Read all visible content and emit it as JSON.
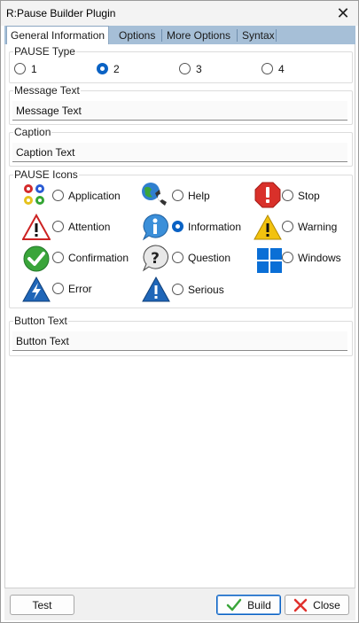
{
  "window": {
    "title": "R:Pause Builder Plugin"
  },
  "tabs": [
    {
      "label": "General Information"
    },
    {
      "label": "Options"
    },
    {
      "label": "More Options"
    },
    {
      "label": "Syntax"
    }
  ],
  "pause_type": {
    "label": "PAUSE Type",
    "options": [
      "1",
      "2",
      "3",
      "4"
    ],
    "selected": "2"
  },
  "message_text": {
    "label": "Message Text",
    "value": "Message Text"
  },
  "caption": {
    "label": "Caption",
    "value": "Caption Text"
  },
  "pause_icons": {
    "label": "PAUSE Icons",
    "options": [
      {
        "label": "Application",
        "icon": "gears-icon",
        "selected": false
      },
      {
        "label": "Help",
        "icon": "help-phone-icon",
        "selected": false
      },
      {
        "label": "Stop",
        "icon": "stop-icon",
        "selected": false
      },
      {
        "label": "Attention",
        "icon": "attention-icon",
        "selected": false
      },
      {
        "label": "Information",
        "icon": "information-icon",
        "selected": true
      },
      {
        "label": "Warning",
        "icon": "warning-icon",
        "selected": false
      },
      {
        "label": "Confirmation",
        "icon": "confirmation-icon",
        "selected": false
      },
      {
        "label": "Question",
        "icon": "question-icon",
        "selected": false
      },
      {
        "label": "Windows",
        "icon": "windows-icon",
        "selected": false
      },
      {
        "label": "Error",
        "icon": "error-icon",
        "selected": false
      },
      {
        "label": "Serious",
        "icon": "serious-icon",
        "selected": false
      }
    ]
  },
  "button_text": {
    "label": "Button Text",
    "value": "Button Text"
  },
  "buttons": {
    "test": "Test",
    "build": "Build",
    "close": "Close"
  },
  "colors": {
    "tab_strip": "#a6bfd7",
    "accent": "#0a62c4",
    "stop_red": "#d9302a",
    "close_red": "#e0302c",
    "check_green": "#3aa53a"
  }
}
